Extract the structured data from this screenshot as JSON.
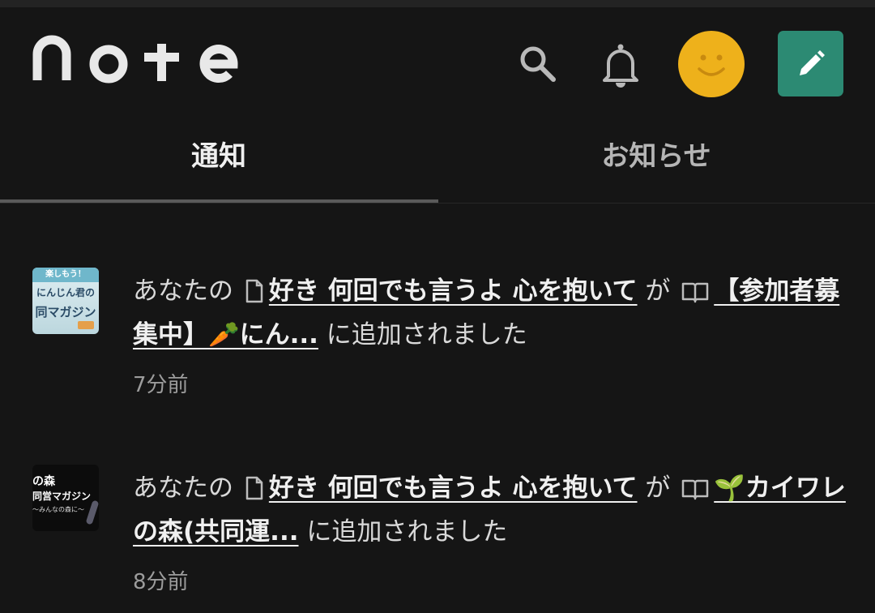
{
  "header": {
    "logo_text": "note",
    "icons": [
      "search-icon",
      "bell-icon",
      "smiley-avatar-icon",
      "pencil-icon"
    ],
    "colors": {
      "avatar": "#eeb11b",
      "write_button": "#2c8a73",
      "background": "#151515"
    }
  },
  "tabs": [
    {
      "label": "通知",
      "active": true
    },
    {
      "label": "お知らせ",
      "active": false
    }
  ],
  "notifications": [
    {
      "prefix": "あなたの",
      "note_title": "好き 何回でも言うよ 心を抱いて",
      "connector": "が",
      "magazine_title": "【参加者募集中】🥕にん...",
      "suffix": "に追加されました",
      "time": "7分前",
      "thumbnail": {
        "line1": "楽しもう！",
        "line2": "にんじん君の",
        "line3": "同マガジン"
      }
    },
    {
      "prefix": "あなたの",
      "note_title": "好き 何回でも言うよ 心を抱いて",
      "connector": "が",
      "magazine_title": "🌱カイワレの森(共同運...",
      "suffix": "に追加されました",
      "time": "8分前",
      "thumbnail": {
        "line1": "の森",
        "line2": "同営マガジン",
        "line3": "〜みんなの森に〜"
      }
    }
  ]
}
